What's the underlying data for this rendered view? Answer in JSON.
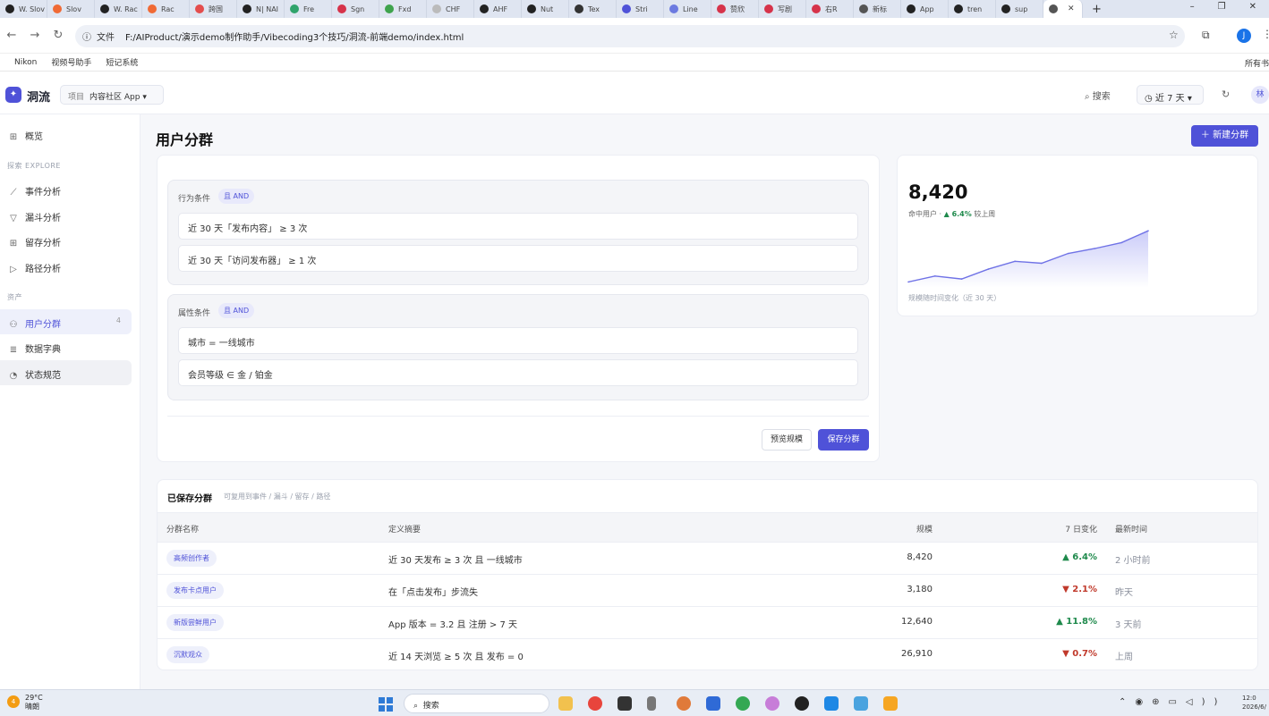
{
  "browser": {
    "tabs": [
      {
        "label": "W. Slov",
        "color": "#222222"
      },
      {
        "label": "Slov",
        "color": "#f06a35"
      },
      {
        "label": "W. Rac",
        "color": "#222222"
      },
      {
        "label": "Rac",
        "color": "#f06a35"
      },
      {
        "label": "跨国",
        "color": "#e44d4d"
      },
      {
        "label": "N| NAI",
        "color": "#222222"
      },
      {
        "label": "Fre",
        "color": "#2fa36b"
      },
      {
        "label": "Sgn",
        "color": "#d6334a"
      },
      {
        "label": "Fxd",
        "color": "#3fa34d"
      },
      {
        "label": "CHF",
        "color": "#bbbbbb"
      },
      {
        "label": "AHF",
        "color": "#222222"
      },
      {
        "label": "Nut",
        "color": "#222222"
      },
      {
        "label": "Tex",
        "color": "#333333"
      },
      {
        "label": "Stri",
        "color": "#4f52d8"
      },
      {
        "label": "Line",
        "color": "#6c7ae0"
      },
      {
        "label": "赞欣",
        "color": "#d6334a"
      },
      {
        "label": "写剧",
        "color": "#d6334a"
      },
      {
        "label": "右R",
        "color": "#d6334a"
      },
      {
        "label": "新标",
        "color": "#555555"
      },
      {
        "label": "App",
        "color": "#222222"
      },
      {
        "label": "tren",
        "color": "#222222"
      },
      {
        "label": "sup",
        "color": "#222222"
      }
    ],
    "active_tab": {
      "label": "",
      "close": "✕"
    },
    "new_tab": "+",
    "window_controls": [
      "–",
      "❐",
      "✕"
    ],
    "address_label": "文件",
    "url": "F:/AIProduct/演示demo制作助手/Vibecoding3个技巧/洞流-前端demo/index.html",
    "profile_initial": "J",
    "bookmarks": [
      "Nikon",
      "视频号助手",
      "短记系统"
    ],
    "bookmarks_right": "所有书"
  },
  "app": {
    "brand": "洞流",
    "project_label": "项目",
    "project_value": "内容社区 App ▾",
    "search_label": "搜索",
    "range_label": "近 7 天 ▾",
    "avatar": "林"
  },
  "sidebar": {
    "overview": "概览",
    "explore_title": "探索 EXPLORE",
    "explore": [
      "事件分析",
      "漏斗分析",
      "留存分析",
      "路径分析"
    ],
    "assets_title": "资产",
    "assets": [
      "用户分群",
      "数据字典",
      "状态规范"
    ],
    "active_badge": "4"
  },
  "page": {
    "title": "用户分群",
    "new_button": "新建分群"
  },
  "conditions": {
    "behavior_label": "行为条件",
    "behavior_tag": "且 AND",
    "behavior_rows": [
      "近 30 天「发布内容」 ≥ 3 次",
      "近 30 天「访问发布器」 ≥ 1 次"
    ],
    "attr_label": "属性条件",
    "attr_tag": "且 AND",
    "attr_rows": [
      "城市 =  一线城市",
      "会员等级 ∈ 金 / 铂金"
    ],
    "preview_button": "预览规模",
    "save_button": "保存分群"
  },
  "summary": {
    "count": "8,420",
    "sub_prefix": "命中用户 ·",
    "change": "▲ 6.4%",
    "sub_suffix": "较上周",
    "caption": "规模随时间变化（近 30 天）"
  },
  "chart_data": {
    "type": "area",
    "title": "",
    "xlabel": "近 30 天",
    "ylabel": "",
    "values": [
      7900,
      7960,
      7930,
      8030,
      8110,
      8090,
      8190,
      8240,
      8300,
      8420
    ]
  },
  "saved": {
    "title": "已保存分群",
    "hint": "可复用到事件 / 漏斗 / 留存 / 路径",
    "headers": {
      "name": "分群名称",
      "def": "定义摘要",
      "size": "规模",
      "change": "7 日变化",
      "updated": "最新时间"
    },
    "rows": [
      {
        "name": "高频创作者",
        "def": "近 30 天发布 ≥ 3 次 且 一线城市",
        "size": "8,420",
        "change": "▲ 6.4%",
        "dir": "up",
        "updated": "2 小时前"
      },
      {
        "name": "发布卡点用户",
        "def": "在「点击发布」步流失",
        "size": "3,180",
        "change": "▼ 2.1%",
        "dir": "down",
        "updated": "昨天"
      },
      {
        "name": "新版尝鲜用户",
        "def": "App 版本 = 3.2 且 注册 > 7 天",
        "size": "12,640",
        "change": "▲ 11.8%",
        "dir": "up",
        "updated": "3 天前"
      },
      {
        "name": "沉默观众",
        "def": "近 14 天浏览 ≥ 5 次 且 发布 = 0",
        "size": "26,910",
        "change": "▼ 0.7%",
        "dir": "down",
        "updated": "上周"
      }
    ]
  },
  "taskbar": {
    "weather_badge": "4",
    "temp": "29°C",
    "weather": "晴朗",
    "search": "搜索",
    "time": "12:0",
    "date": "2026/6/"
  }
}
